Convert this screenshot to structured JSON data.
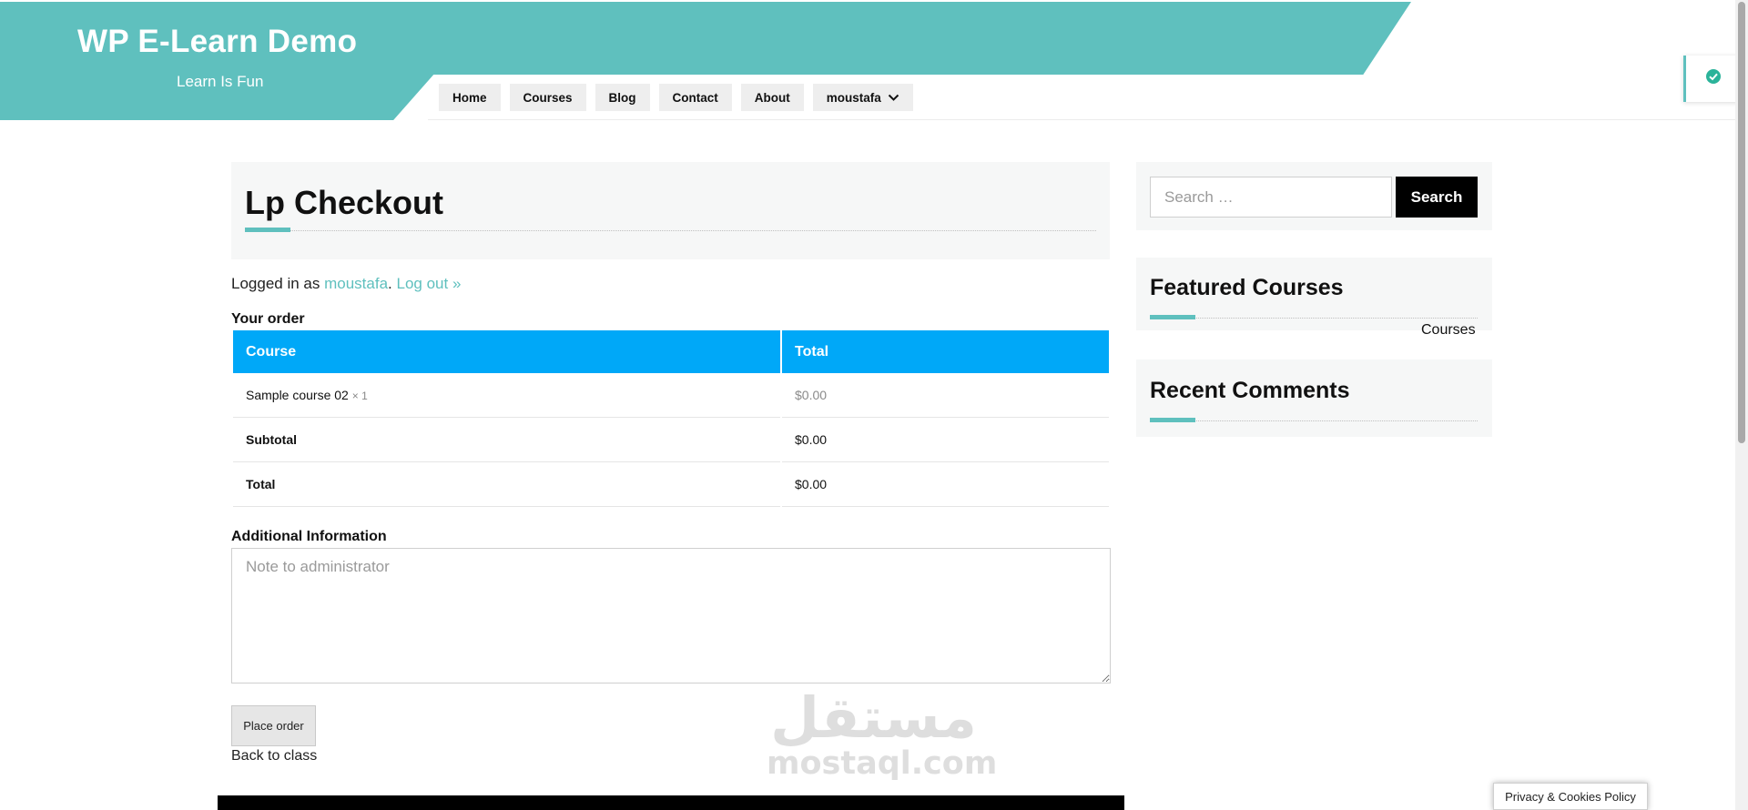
{
  "site": {
    "title": "WP E-Learn Demo",
    "tagline": "Learn Is Fun",
    "accent_color": "#5fc0be"
  },
  "nav": {
    "items": [
      {
        "label": "Home"
      },
      {
        "label": "Courses"
      },
      {
        "label": "Blog"
      },
      {
        "label": "Contact"
      },
      {
        "label": "About"
      },
      {
        "label": "moustafa",
        "has_dropdown": true
      }
    ]
  },
  "toast": {
    "icon": "check-circle-icon"
  },
  "page": {
    "title": "Lp Checkout",
    "logged_in_prefix": "Logged in as ",
    "username": "moustafa",
    "separator": ".",
    "logout_label": "Log out »"
  },
  "order": {
    "heading": "Your order",
    "header_color": "#00a8f8",
    "columns": [
      "Course",
      "Total"
    ],
    "item": {
      "name": "Sample course 02",
      "qty": "× 1",
      "total": "$0.00"
    },
    "subtotal": {
      "label": "Subtotal",
      "value": "$0.00"
    },
    "total": {
      "label": "Total",
      "value": "$0.00"
    }
  },
  "additional": {
    "heading": "Additional Information",
    "placeholder": "Note to administrator"
  },
  "actions": {
    "place_order": "Place order",
    "back_to_class": "Back to class"
  },
  "watermark": {
    "arabic": "مستقل",
    "latin": "mostaql.com"
  },
  "sidebar": {
    "search": {
      "placeholder": "Search …",
      "button": "Search"
    },
    "featured": {
      "title": "Featured Courses",
      "link": "Courses"
    },
    "recent_comments": {
      "title": "Recent Comments"
    }
  },
  "cookie": {
    "label": "Privacy & Cookies Policy"
  }
}
